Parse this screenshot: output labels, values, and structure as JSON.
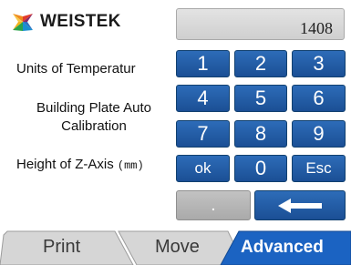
{
  "brand": {
    "name": "WEISTEK",
    "logo_icon": "weistek-logo-icon"
  },
  "display": {
    "value": "1408"
  },
  "settings": {
    "units_label": "Units of Temperatur",
    "bed_label_line1": "Building Plate Auto",
    "bed_label_line2": "Calibration",
    "height_label": "Height of Z-Axis",
    "height_unit": "(mm)"
  },
  "keypad": {
    "k1": "1",
    "k2": "2",
    "k3": "3",
    "k4": "4",
    "k5": "5",
    "k6": "6",
    "k7": "7",
    "k8": "8",
    "k9": "9",
    "ok": "ok",
    "k0": "0",
    "esc": "Esc",
    "dot": ".",
    "backspace_icon": "arrow-left-icon"
  },
  "tabs": {
    "print": "Print",
    "move": "Move",
    "advanced": "Advanced",
    "active": "advanced"
  },
  "colors": {
    "key_blue": "#1f5ba3",
    "key_gray": "#b3b3b3",
    "tab_active": "#1b63c2",
    "tab_inactive": "#d4d4d4"
  }
}
